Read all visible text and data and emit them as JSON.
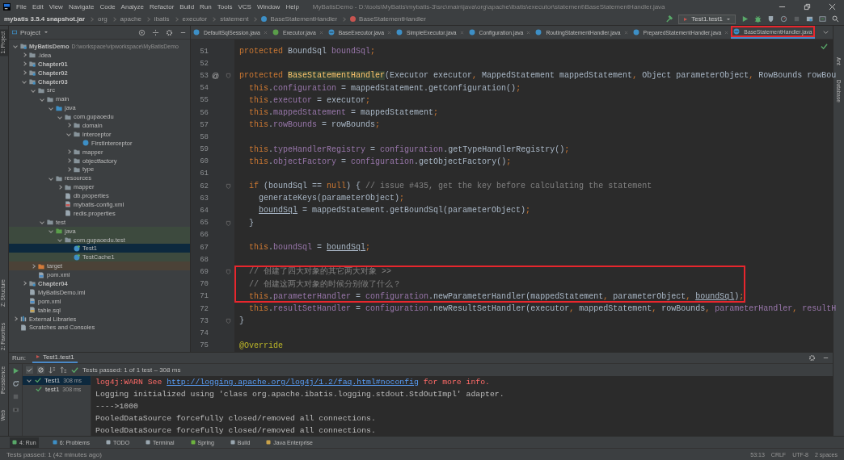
{
  "menu_bar": {
    "items": [
      "File",
      "Edit",
      "View",
      "Navigate",
      "Code",
      "Analyze",
      "Refactor",
      "Build",
      "Run",
      "Tools",
      "VCS",
      "Window",
      "Help"
    ],
    "title": "MyBatisDemo - D:\\tools\\MyBatis\\mybatis-3\\src\\main\\java\\org\\apache\\ibatis\\executor\\statement\\BaseStatementHandler.java"
  },
  "nav_bar": {
    "crumbs": [
      {
        "text": "mybatis 3.5.4 snapshot.jar",
        "kind": "jar"
      },
      {
        "text": "org",
        "kind": "package"
      },
      {
        "text": "apache",
        "kind": "package"
      },
      {
        "text": "ibatis",
        "kind": "package"
      },
      {
        "text": "executor",
        "kind": "package"
      },
      {
        "text": "statement",
        "kind": "package"
      },
      {
        "text": "BaseStatementHandler",
        "kind": "class"
      },
      {
        "text": "BaseStatementHandler",
        "kind": "method"
      }
    ],
    "run_config": "Test1.test1"
  },
  "left_stripe": {
    "top": [
      {
        "label": "1: Project",
        "selected": true
      }
    ],
    "bottom": [
      {
        "label": "Z: Structure",
        "selected": false
      },
      {
        "label": "2: Favorites",
        "selected": false
      },
      {
        "label": "Persistence",
        "selected": false
      },
      {
        "label": "Web",
        "selected": false
      }
    ]
  },
  "right_stripe": [
    "Ant",
    "Database"
  ],
  "project": {
    "title": "Project",
    "tree": [
      {
        "name": "MyBatisDemo",
        "kind": "module",
        "path": "D:\\workspace\\vipworkspace\\MyBatisDemo",
        "expanded": true,
        "selected": false,
        "children": [
          {
            "name": ".idea",
            "kind": "folder",
            "expanded": false,
            "selected": false
          },
          {
            "name": "Chapter01",
            "kind": "module",
            "expanded": false,
            "selected": false
          },
          {
            "name": "Chapter02",
            "kind": "module",
            "expanded": false,
            "selected": false
          },
          {
            "name": "Chapter03",
            "kind": "module",
            "expanded": true,
            "selected": false,
            "children": [
              {
                "name": "src",
                "kind": "folder",
                "expanded": true,
                "selected": false,
                "children": [
                  {
                    "name": "main",
                    "kind": "folder",
                    "expanded": true,
                    "selected": false,
                    "children": [
                      {
                        "name": "java",
                        "kind": "source-folder",
                        "expanded": true,
                        "selected": false,
                        "children": [
                          {
                            "name": "com.gupaoedu",
                            "kind": "package",
                            "expanded": true,
                            "selected": false,
                            "children": [
                              {
                                "name": "domain",
                                "kind": "package",
                                "expanded": false,
                                "selected": false
                              },
                              {
                                "name": "interceptor",
                                "kind": "package",
                                "expanded": true,
                                "selected": false,
                                "children": [
                                  {
                                    "name": "FirstInterceptor",
                                    "kind": "class",
                                    "selected": false
                                  }
                                ]
                              },
                              {
                                "name": "mapper",
                                "kind": "package",
                                "expanded": false,
                                "selected": false
                              },
                              {
                                "name": "objectfactory",
                                "kind": "package",
                                "expanded": false,
                                "selected": false
                              },
                              {
                                "name": "type",
                                "kind": "package",
                                "expanded": false,
                                "selected": false
                              }
                            ]
                          }
                        ]
                      },
                      {
                        "name": "resources",
                        "kind": "resources-folder",
                        "expanded": true,
                        "selected": false,
                        "children": [
                          {
                            "name": "mapper",
                            "kind": "folder",
                            "expanded": false,
                            "selected": false
                          },
                          {
                            "name": "db.properties",
                            "kind": "properties",
                            "selected": false
                          },
                          {
                            "name": "mybatis-config.xml",
                            "kind": "xml",
                            "selected": false
                          },
                          {
                            "name": "redis.properties",
                            "kind": "properties",
                            "selected": false
                          }
                        ]
                      }
                    ]
                  },
                  {
                    "name": "test",
                    "kind": "folder",
                    "expanded": true,
                    "selected": false,
                    "children": [
                      {
                        "name": "java",
                        "kind": "test-folder",
                        "test_source": true,
                        "expanded": true,
                        "selected": false,
                        "children": [
                          {
                            "name": "com.gupaoedu.test",
                            "kind": "package",
                            "test_source": true,
                            "expanded": true,
                            "selected": false,
                            "children": [
                              {
                                "name": "Test1",
                                "kind": "test-class",
                                "test_source": true,
                                "selected": true
                              },
                              {
                                "name": "TestCache1",
                                "kind": "test-class",
                                "test_source": true,
                                "selected": false
                              }
                            ]
                          }
                        ]
                      }
                    ]
                  }
                ]
              },
              {
                "name": "target",
                "kind": "excluded-folder",
                "expanded": false,
                "selected": false
              },
              {
                "name": "pom.xml",
                "kind": "maven",
                "selected": false
              }
            ]
          },
          {
            "name": "Chapter04",
            "kind": "module",
            "expanded": false,
            "selected": false
          },
          {
            "name": "MyBatisDemo.iml",
            "kind": "iml",
            "selected": false
          },
          {
            "name": "pom.xml",
            "kind": "maven",
            "selected": false
          },
          {
            "name": "table.sql",
            "kind": "sql",
            "selected": false
          }
        ]
      },
      {
        "name": "External Libraries",
        "kind": "libraries",
        "expanded": false,
        "selected": false
      },
      {
        "name": "Scratches and Consoles",
        "kind": "scratches",
        "selected": false
      }
    ]
  },
  "editor": {
    "tabs": [
      {
        "name": "DefaultSqlSession.java",
        "kind": "class",
        "selected": false,
        "boxed": false
      },
      {
        "name": "Executor.java",
        "kind": "interface",
        "selected": false,
        "boxed": false
      },
      {
        "name": "BaseExecutor.java",
        "kind": "abstract",
        "selected": false,
        "boxed": false
      },
      {
        "name": "SimpleExecutor.java",
        "kind": "class",
        "selected": false,
        "boxed": false
      },
      {
        "name": "Configuration.java",
        "kind": "class",
        "selected": false,
        "boxed": false
      },
      {
        "name": "RoutingStatementHandler.java",
        "kind": "class",
        "selected": false,
        "boxed": false
      },
      {
        "name": "PreparedStatementHandler.java",
        "kind": "class",
        "selected": false,
        "boxed": false
      },
      {
        "name": "BaseStatementHandler.java",
        "kind": "abstract",
        "selected": true,
        "boxed": true
      }
    ],
    "lines": [
      {
        "number": "51",
        "fold": false,
        "boxed": false,
        "tokens": [
          {
            "text": "protected ",
            "kind": "keyword"
          },
          {
            "text": "BoundSql ",
            "kind": "plain"
          },
          {
            "text": "boundSql",
            "kind": "field"
          },
          {
            "text": ";",
            "kind": "keyword"
          }
        ]
      },
      {
        "number": "52",
        "fold": false,
        "boxed": false
      },
      {
        "number": "53",
        "marker": "@",
        "fold": true,
        "boxed": false,
        "tokens": [
          {
            "text": "protected ",
            "kind": "keyword"
          },
          {
            "text": "BaseStatementHandler",
            "kind": "declaration"
          },
          {
            "text": "(Executor executor",
            "kind": "plain"
          },
          {
            "text": ", ",
            "kind": "keyword"
          },
          {
            "text": "MappedStatement mappedStatement",
            "kind": "plain"
          },
          {
            "text": ", ",
            "kind": "keyword"
          },
          {
            "text": "Object parameterObject",
            "kind": "plain"
          },
          {
            "text": ", ",
            "kind": "keyword"
          },
          {
            "text": "RowBounds rowBou",
            "kind": "plain"
          }
        ]
      },
      {
        "number": "54",
        "fold": false,
        "boxed": false,
        "tokens": [
          {
            "text": "  this",
            "kind": "keyword"
          },
          {
            "text": ".",
            "kind": "plain"
          },
          {
            "text": "configuration",
            "kind": "field"
          },
          {
            "text": " = mappedStatement.getConfiguration()",
            "kind": "plain"
          },
          {
            "text": ";",
            "kind": "keyword"
          }
        ]
      },
      {
        "number": "55",
        "fold": false,
        "boxed": false,
        "tokens": [
          {
            "text": "  this",
            "kind": "keyword"
          },
          {
            "text": ".",
            "kind": "plain"
          },
          {
            "text": "executor",
            "kind": "field"
          },
          {
            "text": " = executor",
            "kind": "plain"
          },
          {
            "text": ";",
            "kind": "keyword"
          }
        ]
      },
      {
        "number": "56",
        "fold": false,
        "boxed": false,
        "tokens": [
          {
            "text": "  this",
            "kind": "keyword"
          },
          {
            "text": ".",
            "kind": "plain"
          },
          {
            "text": "mappedStatement",
            "kind": "field"
          },
          {
            "text": " = mappedStatement",
            "kind": "plain"
          },
          {
            "text": ";",
            "kind": "keyword"
          }
        ]
      },
      {
        "number": "57",
        "fold": false,
        "boxed": false,
        "tokens": [
          {
            "text": "  this",
            "kind": "keyword"
          },
          {
            "text": ".",
            "kind": "plain"
          },
          {
            "text": "rowBounds",
            "kind": "field"
          },
          {
            "text": " = rowBounds",
            "kind": "plain"
          },
          {
            "text": ";",
            "kind": "keyword"
          }
        ]
      },
      {
        "number": "58",
        "fold": false,
        "boxed": false
      },
      {
        "number": "59",
        "fold": false,
        "boxed": false,
        "tokens": [
          {
            "text": "  this",
            "kind": "keyword"
          },
          {
            "text": ".",
            "kind": "plain"
          },
          {
            "text": "typeHandlerRegistry",
            "kind": "field"
          },
          {
            "text": " = ",
            "kind": "plain"
          },
          {
            "text": "configuration",
            "kind": "field"
          },
          {
            "text": ".getTypeHandlerRegistry()",
            "kind": "plain"
          },
          {
            "text": ";",
            "kind": "keyword"
          }
        ]
      },
      {
        "number": "60",
        "fold": false,
        "boxed": false,
        "tokens": [
          {
            "text": "  this",
            "kind": "keyword"
          },
          {
            "text": ".",
            "kind": "plain"
          },
          {
            "text": "objectFactory",
            "kind": "field"
          },
          {
            "text": " = ",
            "kind": "plain"
          },
          {
            "text": "configuration",
            "kind": "field"
          },
          {
            "text": ".getObjectFactory()",
            "kind": "plain"
          },
          {
            "text": ";",
            "kind": "keyword"
          }
        ]
      },
      {
        "number": "61",
        "fold": false,
        "boxed": false
      },
      {
        "number": "62",
        "fold": true,
        "boxed": false,
        "tokens": [
          {
            "text": "  if ",
            "kind": "keyword"
          },
          {
            "text": "(boundSql == ",
            "kind": "plain"
          },
          {
            "text": "null",
            "kind": "keyword"
          },
          {
            "text": ") { ",
            "kind": "plain"
          },
          {
            "text": "// issue #435, get the key before calculating the statement",
            "kind": "comment"
          }
        ]
      },
      {
        "number": "63",
        "fold": false,
        "boxed": false,
        "tokens": [
          {
            "text": "    generateKeys(parameterObject)",
            "kind": "plain"
          },
          {
            "text": ";",
            "kind": "keyword"
          }
        ]
      },
      {
        "number": "64",
        "fold": false,
        "boxed": false,
        "tokens": [
          {
            "text": "    boundSql",
            "kind": "underlined"
          },
          {
            "text": " = mappedStatement.getBoundSql(parameterObject)",
            "kind": "plain"
          },
          {
            "text": ";",
            "kind": "keyword"
          }
        ]
      },
      {
        "number": "65",
        "fold": true,
        "boxed": false,
        "tokens": [
          {
            "text": "  }",
            "kind": "plain"
          }
        ]
      },
      {
        "number": "66",
        "fold": false,
        "boxed": false
      },
      {
        "number": "67",
        "fold": false,
        "boxed": false,
        "tokens": [
          {
            "text": "  this",
            "kind": "keyword"
          },
          {
            "text": ".",
            "kind": "plain"
          },
          {
            "text": "boundSql",
            "kind": "field"
          },
          {
            "text": " = ",
            "kind": "plain"
          },
          {
            "text": "boundSql",
            "kind": "underlined"
          },
          {
            "text": ";",
            "kind": "keyword"
          }
        ]
      },
      {
        "number": "68",
        "fold": false,
        "boxed": false
      },
      {
        "number": "69",
        "fold": true,
        "boxed": true,
        "tokens": [
          {
            "text": "  // 创建了四大对象的其它两大对象 >>",
            "kind": "comment"
          }
        ]
      },
      {
        "number": "70",
        "fold": false,
        "boxed": true,
        "tokens": [
          {
            "text": "  // 创建这两大对象的时候分别做了什么？",
            "kind": "comment"
          }
        ]
      },
      {
        "number": "71",
        "fold": false,
        "boxed": true,
        "tokens": [
          {
            "text": "  this",
            "kind": "keyword"
          },
          {
            "text": ".",
            "kind": "plain"
          },
          {
            "text": "parameterHandler",
            "kind": "field"
          },
          {
            "text": " = ",
            "kind": "plain"
          },
          {
            "text": "configuration",
            "kind": "field"
          },
          {
            "text": ".newParameterHandler(mappedStatement",
            "kind": "plain"
          },
          {
            "text": ", ",
            "kind": "keyword"
          },
          {
            "text": "parameterObject",
            "kind": "plain"
          },
          {
            "text": ", ",
            "kind": "keyword"
          },
          {
            "text": "boundSql",
            "kind": "underlined"
          },
          {
            "text": ")",
            "kind": "plain"
          },
          {
            "text": ";",
            "kind": "keyword"
          }
        ]
      },
      {
        "number": "72",
        "fold": false,
        "boxed": false,
        "tokens": [
          {
            "text": "  this",
            "kind": "keyword"
          },
          {
            "text": ".",
            "kind": "plain"
          },
          {
            "text": "resultSetHandler",
            "kind": "field"
          },
          {
            "text": " = ",
            "kind": "plain"
          },
          {
            "text": "configuration",
            "kind": "field"
          },
          {
            "text": ".newResultSetHandler(executor",
            "kind": "plain"
          },
          {
            "text": ", ",
            "kind": "keyword"
          },
          {
            "text": "mappedStatement",
            "kind": "plain"
          },
          {
            "text": ", ",
            "kind": "keyword"
          },
          {
            "text": "rowBounds",
            "kind": "plain"
          },
          {
            "text": ", ",
            "kind": "keyword"
          },
          {
            "text": "parameterHandler",
            "kind": "field"
          },
          {
            "text": ", ",
            "kind": "keyword"
          },
          {
            "text": "resultH",
            "kind": "field"
          }
        ]
      },
      {
        "number": "73",
        "fold": true,
        "boxed": false,
        "tokens": [
          {
            "text": "}",
            "kind": "plain"
          }
        ]
      },
      {
        "number": "74",
        "fold": false,
        "boxed": false
      },
      {
        "number": "75",
        "fold": false,
        "boxed": false,
        "tokens": [
          {
            "text": "@Override",
            "kind": "annotation"
          }
        ]
      }
    ]
  },
  "run_panel": {
    "title": "Run:",
    "tab": "Test1.test1",
    "summary": "Tests passed: 1 of 1 test – 308 ms",
    "tests": [
      {
        "name": "Test1",
        "time": "308 ms",
        "expanded": true,
        "children": [
          {
            "name": "test1",
            "time": "308 ms"
          }
        ]
      }
    ],
    "console": [
      {
        "parts": [
          {
            "text": "log4j:WARN See ",
            "kind": "error"
          },
          {
            "text": "http://logging.apache.org/log4j/1.2/faq.html#noconfig",
            "kind": "link"
          },
          {
            "text": " for more info.",
            "kind": "error"
          }
        ]
      },
      {
        "parts": [
          {
            "text": "Logging initialized using 'class org.apache.ibatis.logging.stdout.StdOutImpl' adapter.",
            "kind": "normal"
          }
        ]
      },
      {
        "parts": [
          {
            "text": "---->1000",
            "kind": "normal"
          }
        ]
      },
      {
        "parts": [
          {
            "text": "PooledDataSource forcefully closed/removed all connections.",
            "kind": "normal"
          }
        ]
      },
      {
        "parts": [
          {
            "text": "PooledDataSource forcefully closed/removed all connections.",
            "kind": "normal"
          }
        ]
      }
    ]
  },
  "tool_strip": [
    {
      "label": "4: Run",
      "kind": "run",
      "selected": true
    },
    {
      "label": "6: Problems",
      "kind": "problems",
      "selected": false
    },
    {
      "label": "TODO",
      "kind": "todo",
      "selected": false
    },
    {
      "label": "Terminal",
      "kind": "terminal",
      "selected": false
    },
    {
      "label": "Spring",
      "kind": "spring",
      "selected": false
    },
    {
      "label": "Build",
      "kind": "build",
      "selected": false
    },
    {
      "label": "Java Enterprise",
      "kind": "enterprise",
      "selected": false
    }
  ],
  "status_bar": {
    "message": "Tests passed: 1 (42 minutes ago)",
    "items": [
      "53:13",
      "CRLF",
      "UTF-8",
      "2 spaces"
    ]
  }
}
